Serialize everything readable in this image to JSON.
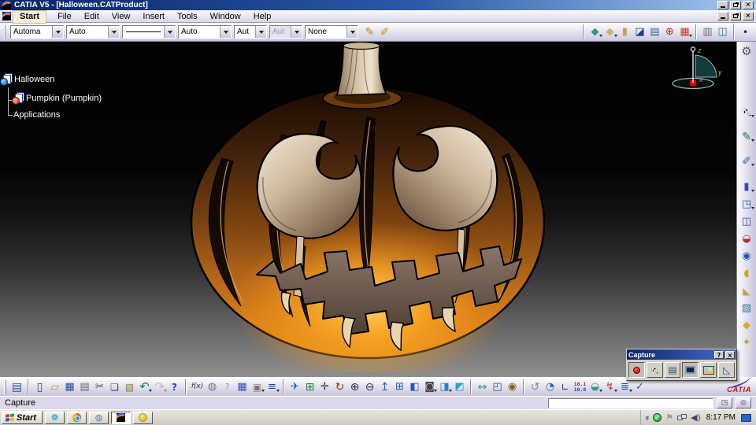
{
  "titlebar": {
    "title": "CATIA V5 - [Halloween.CATProduct]"
  },
  "window_controls": {
    "close": "×"
  },
  "menubar": {
    "items": [
      "Start",
      "File",
      "Edit",
      "View",
      "Insert",
      "Tools",
      "Window",
      "Help"
    ],
    "highlighted": "Start"
  },
  "gfx_toolbar": {
    "dropdowns": [
      {
        "name": "fill-color-select",
        "value": "Automa",
        "w": 68
      },
      {
        "name": "transparency-select",
        "value": "Auto",
        "w": 68
      },
      {
        "name": "line-type-select",
        "value": "line",
        "line": true,
        "w": 68
      },
      {
        "name": "line-weight-select",
        "value": "Auto",
        "w": 68
      },
      {
        "name": "point-symbol-select",
        "value": "Aut",
        "w": 42
      },
      {
        "name": "render-mode-select",
        "value": "Aut",
        "w": 42,
        "disabled": true
      },
      {
        "name": "layer-select",
        "value": "None",
        "w": 68
      }
    ],
    "icons": [
      {
        "n": "painter-icon",
        "g": "✎",
        "c": "#c08514",
        "fs": 14
      },
      {
        "n": "wizard-eyedropper-icon",
        "g": "✐",
        "c": "#d09010",
        "fs": 14
      },
      {
        "sp": 238
      },
      {
        "sep": 1
      },
      {
        "n": "isometric-shading-icon",
        "g": "◆",
        "c": "#2a9d8f",
        "fs": 13,
        "dd": 1
      },
      {
        "n": "shading-icon",
        "g": "◆",
        "c": "#c8b560",
        "fs": 13,
        "dd": 1
      },
      {
        "n": "shading-edges-icon",
        "g": "▮",
        "c": "#caa23c",
        "fs": 13
      },
      {
        "n": "hidden-line-icon",
        "g": "◪",
        "c": "#1f3f7a",
        "fs": 13
      },
      {
        "n": "wireframe-icon",
        "g": "▤",
        "c": "#3a5fa0",
        "fs": 13
      },
      {
        "n": "normal-view-icon",
        "g": "⊕",
        "c": "#b03020",
        "fs": 13
      },
      {
        "n": "render-style-icon",
        "g": "▦",
        "c": "#c04020",
        "fs": 13,
        "dd": 1
      },
      {
        "sep": 1
      },
      {
        "n": "tile-window-icon",
        "g": "▥",
        "c": "#6a6a8a",
        "fs": 13
      },
      {
        "n": "swap-view-icon",
        "g": "◫",
        "c": "#2a7d8f",
        "fs": 13
      },
      {
        "sep": 1
      },
      {
        "n": "point-icon",
        "g": "•",
        "c": "#202060",
        "fs": 12
      },
      {
        "n": "line-icon",
        "g": "∕",
        "c": "#202060",
        "fs": 13
      },
      {
        "n": "plane-icon",
        "g": "▱",
        "c": "#b8a040",
        "fs": 12
      },
      {
        "sep": 1
      },
      {
        "n": "spring-icon",
        "g": "ξ",
        "c": "#2040a0",
        "fs": 13,
        "dd": 1
      },
      {
        "n": "catalog-icon",
        "g": "◫",
        "c": "#2060c0",
        "fs": 13
      },
      {
        "n": "constraint-icon",
        "g": "◌",
        "c": "#2040a0",
        "fs": 14,
        "dd": 1
      },
      {
        "sep": 1
      },
      {
        "n": "select-frame-icon",
        "g": "▣",
        "c": "#208040",
        "fs": 13
      }
    ]
  },
  "right_toolbar": {
    "icons": [
      {
        "n": "settings-gear-icon",
        "g": "⚙",
        "c": "#556",
        "fs": 15
      },
      {
        "sp": 52,
        "v": 1
      },
      {
        "n": "select-cursor-icon",
        "g": "↖",
        "c": "#f5f5f5",
        "fs": 15,
        "sh": 1,
        "dd": 1
      },
      {
        "sp": 6,
        "v": 1
      },
      {
        "n": "sketcher-icon",
        "g": "✎",
        "c": "#207040",
        "fs": 14,
        "dd": 1
      },
      {
        "sp": 6,
        "v": 1
      },
      {
        "n": "part-body-icon",
        "g": "✐",
        "c": "#4060a0",
        "fs": 14,
        "dd": 1
      },
      {
        "sp": 8,
        "v": 1
      },
      {
        "n": "pad-icon",
        "g": "▮",
        "c": "#3050b0",
        "fs": 13,
        "dd": 1
      },
      {
        "n": "pocket-icon",
        "g": "◳",
        "c": "#3050b0",
        "fs": 13,
        "dd": 1
      },
      {
        "n": "mirror-icon",
        "g": "◫",
        "c": "#3050b0",
        "fs": 13
      },
      {
        "n": "shell-icon",
        "g": "◒",
        "c": "#b03030",
        "fs": 13
      },
      {
        "n": "hole-icon",
        "g": "◉",
        "c": "#3050b0",
        "fs": 13
      },
      {
        "n": "fillet-icon",
        "g": "◖",
        "c": "#c8a030",
        "fs": 13
      },
      {
        "n": "chamfer-icon",
        "g": "◣",
        "c": "#c8a030",
        "fs": 12
      },
      {
        "n": "box-icon",
        "g": "▧",
        "c": "#2a7d8f",
        "fs": 13
      },
      {
        "n": "apply-material-icon",
        "g": "◆",
        "c": "#d4b020",
        "fs": 13
      },
      {
        "n": "measure-tool-icon",
        "g": "✦",
        "c": "#c0a020",
        "fs": 13
      }
    ]
  },
  "bottom_toolbar": {
    "icons": [
      {
        "h": 1
      },
      {
        "n": "workbench-icon",
        "g": "▤",
        "c": "#3050a0",
        "fs": 14
      },
      {
        "sep": 1
      },
      {
        "n": "new-document-icon",
        "g": "▯",
        "c": "#445",
        "fs": 14
      },
      {
        "n": "open-icon",
        "g": "▱",
        "c": "#c8962c",
        "fs": 14
      },
      {
        "n": "save-icon",
        "g": "▦",
        "c": "#2848a0",
        "fs": 13
      },
      {
        "n": "print-icon",
        "g": "▤",
        "c": "#667",
        "fs": 13
      },
      {
        "n": "cut-icon",
        "g": "✂",
        "c": "#445",
        "fs": 13
      },
      {
        "n": "copy-icon",
        "g": "❏",
        "c": "#446",
        "fs": 12
      },
      {
        "n": "paste-icon",
        "g": "▧",
        "c": "#8a7a30",
        "fs": 12
      },
      {
        "n": "undo-icon",
        "g": "↶",
        "c": "#108030",
        "fs": 15,
        "dd": 1
      },
      {
        "n": "redo-icon",
        "g": "↷",
        "c": "#888",
        "fs": 15,
        "dd": 1,
        "dis": 1
      },
      {
        "n": "whats-this-icon",
        "g": "?",
        "c": "#2040c0",
        "fs": 12,
        "bold": 1
      },
      {
        "sep": 1
      },
      {
        "n": "formula-icon",
        "g": "f(x)",
        "c": "#333",
        "fs": 9,
        "it": 1
      },
      {
        "n": "comment-icon",
        "g": "◍",
        "c": "#778",
        "fs": 13
      },
      {
        "n": "knowledge-icon",
        "g": "?",
        "c": "#888",
        "fs": 10
      },
      {
        "n": "design-table-icon",
        "g": "▦",
        "c": "#2a52be",
        "fs": 13
      },
      {
        "n": "lock-icon",
        "g": "▣",
        "c": "#777",
        "fs": 12,
        "dd": 1
      },
      {
        "n": "equivalent-dimensions-icon",
        "g": "≡",
        "c": "#2040a0",
        "fs": 13,
        "dd": 1
      },
      {
        "sep": 1
      },
      {
        "n": "fly-mode-icon",
        "g": "✈",
        "c": "#2060c0",
        "fs": 13
      },
      {
        "n": "fit-all-in-icon",
        "g": "⊞",
        "c": "#208040",
        "fs": 14
      },
      {
        "n": "pan-icon",
        "g": "✛",
        "c": "#333",
        "fs": 13
      },
      {
        "n": "rotate-icon",
        "g": "↻",
        "c": "#884010",
        "fs": 14
      },
      {
        "n": "zoom-in-icon",
        "g": "⊕",
        "c": "#335",
        "fs": 14
      },
      {
        "n": "zoom-out-icon",
        "g": "⊖",
        "c": "#335",
        "fs": 14
      },
      {
        "n": "normal-to-icon",
        "g": "↥",
        "c": "#3060b0",
        "fs": 14
      },
      {
        "n": "multi-view-icon",
        "g": "⊞",
        "c": "#2a52be",
        "fs": 13
      },
      {
        "n": "iso-view-icon",
        "g": "◧",
        "c": "#2a52be",
        "fs": 13
      },
      {
        "n": "view-mode-icon",
        "g": "◙",
        "c": "#444",
        "fs": 13,
        "dd": 1
      },
      {
        "n": "hide-show-icon",
        "g": "◨",
        "c": "#2a82be",
        "fs": 13,
        "dd": 1
      },
      {
        "n": "look-at-icon",
        "g": "◩",
        "c": "#2aa2be",
        "fs": 13
      },
      {
        "sep": 1
      },
      {
        "n": "measure-between-icon",
        "g": "↔",
        "c": "#2a9d8f",
        "fs": 14
      },
      {
        "n": "measure-item-icon",
        "g": "◰",
        "c": "#3050a0",
        "fs": 13
      },
      {
        "n": "mass-properties-icon",
        "g": "◉",
        "c": "#806020",
        "fs": 13
      },
      {
        "sep": 1
      },
      {
        "n": "update-icon",
        "g": "↺",
        "c": "#888",
        "fs": 14
      },
      {
        "n": "world-icon",
        "g": "◔",
        "c": "#3060b0",
        "fs": 13
      },
      {
        "n": "axis-system-icon",
        "g": "∟",
        "c": "#334",
        "fs": 12
      },
      {
        "n": "units-icon",
        "g": "10.1\n10.0",
        "two": 1,
        "cs": [
          "#cc2020",
          "#2040c0"
        ]
      },
      {
        "n": "apply-material-icon",
        "g": "◒",
        "c": "#2a9d8f",
        "fs": 13,
        "dd": 1
      },
      {
        "n": "knowledge-inspector-icon",
        "g": "↯",
        "c": "#c03030",
        "fs": 13,
        "dd": 1
      },
      {
        "n": "catalog-browser-icon",
        "g": "≣",
        "c": "#2050b0",
        "fs": 13,
        "dd": 1
      },
      {
        "n": "check-analysis-icon",
        "g": "✓",
        "c": "#2050b0",
        "fs": 13
      }
    ]
  },
  "tree": {
    "items": [
      {
        "label": "Halloween"
      },
      {
        "label": "Pumpkin (Pumpkin)"
      },
      {
        "label": "Applications"
      }
    ]
  },
  "compass": {
    "axes": [
      "z",
      "y",
      "x"
    ]
  },
  "capture": {
    "title": "Capture",
    "help": "?",
    "close": "×"
  },
  "statusbar": {
    "message": "Capture"
  },
  "taskbar": {
    "start_label": "Start",
    "clock": "8:17 PM"
  },
  "logo": {
    "text": "CATIA"
  },
  "colors": {
    "accent_orange": "#e8921c",
    "titlebar_blue": "#0a246a",
    "viewport_top": "#020202",
    "viewport_bottom": "#8f8f8f"
  }
}
